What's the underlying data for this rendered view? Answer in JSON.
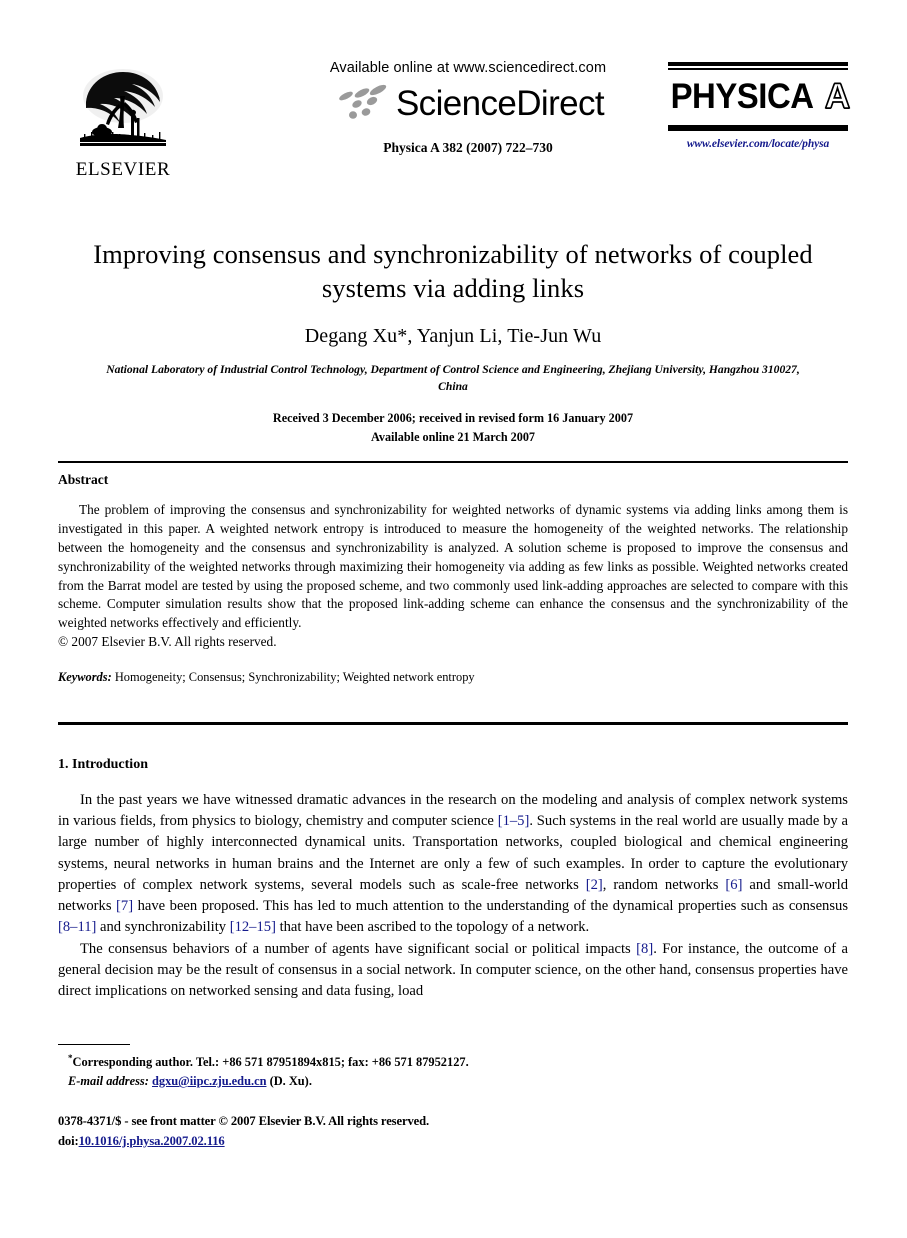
{
  "masthead": {
    "publisher_name": "ELSEVIER",
    "publisher_logo_icon": "elsevier-tree-icon",
    "available_online": "Available online at www.sciencedirect.com",
    "sciencedirect_wordmark": "ScienceDirect",
    "sciencedirect_swoosh_icon": "sciencedirect-swoosh-icon",
    "citation": "Physica A 382 (2007) 722–730",
    "journal_name": "PHYSICA",
    "journal_series": "A",
    "journal_url": "www.elsevier.com/locate/physa"
  },
  "article": {
    "title": "Improving consensus and synchronizability of networks of coupled systems via adding links",
    "authors": "Degang Xu*, Yanjun Li, Tie-Jun Wu",
    "authors_plain": "Degang Xu, Yanjun Li, Tie-Jun Wu",
    "corresponding_marker": "*",
    "affiliation_line1": "National Laboratory of Industrial Control Technology, Department of Control Science and Engineering, Zhejiang University,",
    "affiliation_line2": "Hangzhou 310027, China",
    "received": "Received 3 December 2006; received in revised form 16 January 2007",
    "available_online": "Available online 21 March 2007"
  },
  "abstract": {
    "heading": "Abstract",
    "text": "The problem of improving the consensus and synchronizability for weighted networks of dynamic systems via adding links among them is investigated in this paper. A weighted network entropy is introduced to measure the homogeneity of the weighted networks. The relationship between the homogeneity and the consensus and synchronizability is analyzed. A solution scheme is proposed to improve the consensus and synchronizability of the weighted networks through maximizing their homogeneity via adding as few links as possible. Weighted networks created from the Barrat model are tested by using the proposed scheme, and two commonly used link-adding approaches are selected to compare with this scheme. Computer simulation results show that the proposed link-adding scheme can enhance the consensus and the synchronizability of the weighted networks effectively and efficiently.",
    "copyright": "© 2007 Elsevier B.V. All rights reserved.",
    "keywords_label": "Keywords:",
    "keywords_values": "Homogeneity; Consensus; Synchronizability; Weighted network entropy"
  },
  "introduction": {
    "heading": "1.  Introduction",
    "paragraph1_part1": "In the past years we have witnessed dramatic advances in the research on the modeling and analysis of complex network systems in various fields, from physics to biology, chemistry and computer science ",
    "paragraph1_ref1": "[1–5]",
    "paragraph1_part2": ". Such systems in the real world are usually made by a large number of highly interconnected dynamical units. Transportation networks, coupled biological and chemical engineering systems, neural networks in human brains and the Internet are only a few of such examples. In order to capture the evolutionary properties of complex network systems, several models such as scale-free networks ",
    "paragraph1_ref2": "[2]",
    "paragraph1_part3": ", random networks ",
    "paragraph1_ref3": "[6]",
    "paragraph1_part4": " and small-world networks ",
    "paragraph1_ref4": "[7]",
    "paragraph1_part5": " have been proposed. This has led to much attention to the understanding of the dynamical properties such as consensus ",
    "paragraph1_ref5": "[8–11]",
    "paragraph1_part6": " and synchronizability ",
    "paragraph1_ref6": "[12–15]",
    "paragraph1_part7": " that have been ascribed to the topology of a network.",
    "paragraph2_part1": "The consensus behaviors of a number of agents have significant social or political impacts ",
    "paragraph2_ref1": "[8]",
    "paragraph2_part2": ". For instance, the outcome of a general decision may be the result of consensus in a social network. In computer science, on the other hand, consensus properties have direct implications on networked sensing and data fusing, load"
  },
  "footnotes": {
    "corresponding_marker": "*",
    "corresponding_text": "Corresponding author. Tel.: +86 571 87951894x815; fax: +86 571 87952127.",
    "email_label": "E-mail address:",
    "email_address": "dgxu@iipc.zju.edu.cn",
    "email_owner": "(D. Xu)."
  },
  "imprint": {
    "issn_line": "0378-4371/$ - see front matter © 2007 Elsevier B.V. All rights reserved.",
    "doi_label": "doi:",
    "doi_value": "10.1016/j.physa.2007.02.116"
  },
  "colors": {
    "link": "#141a8c",
    "text": "#000000",
    "background": "#ffffff"
  }
}
